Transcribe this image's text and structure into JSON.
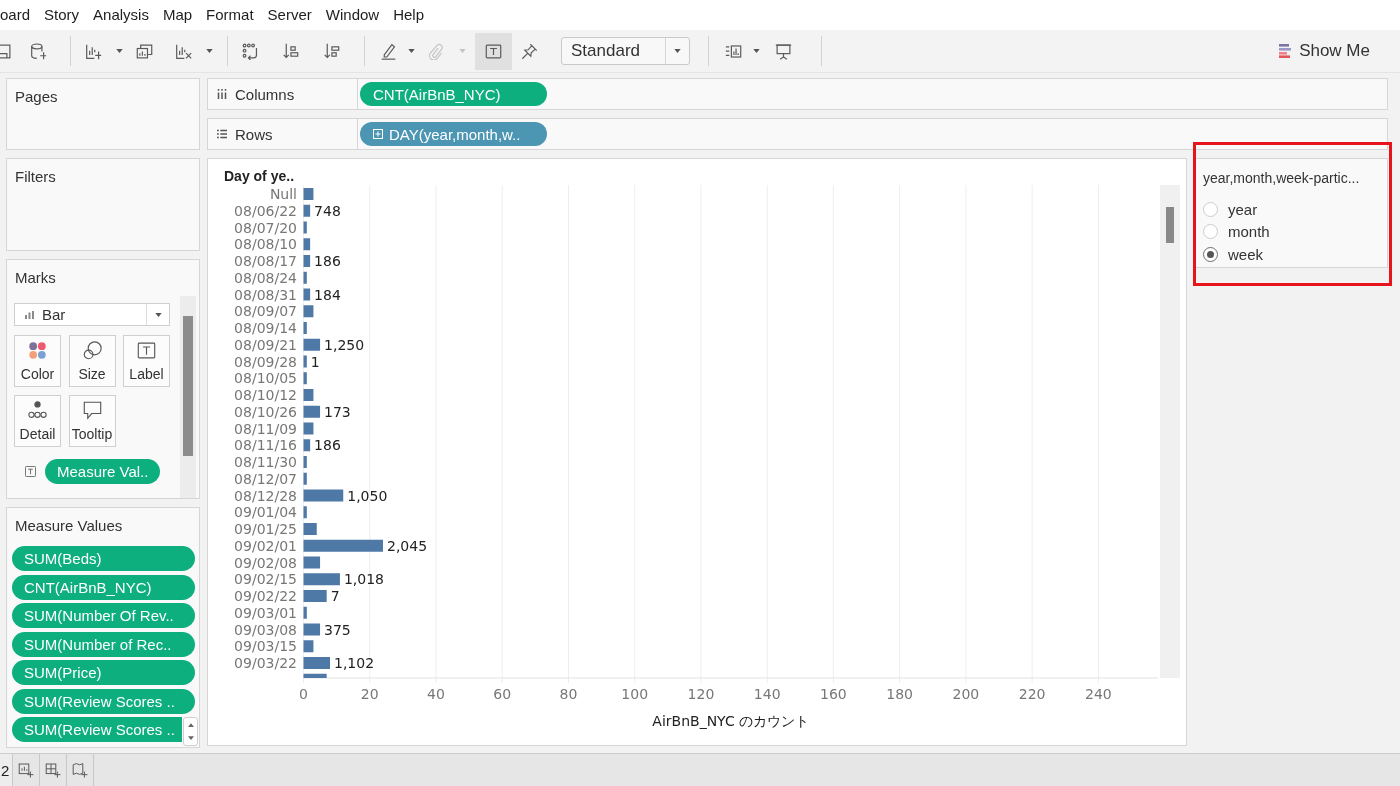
{
  "menu": [
    "oard",
    "Story",
    "Analysis",
    "Map",
    "Format",
    "Server",
    "Window",
    "Help"
  ],
  "toolbar": {
    "text_toggle": {
      "selected": true
    },
    "attach_button": {
      "disabled": true
    },
    "view_dropdown": {
      "value": "Standard"
    },
    "show_me": {
      "label": "Show Me"
    }
  },
  "left_panel": {
    "pages": {
      "title": "Pages"
    },
    "filters": {
      "title": "Filters"
    },
    "marks": {
      "title": "Marks",
      "mark_type": "Bar",
      "cards": [
        {
          "label": "Color",
          "kind": "color"
        },
        {
          "label": "Size",
          "kind": "size"
        },
        {
          "label": "Label",
          "kind": "label"
        },
        {
          "label": "Detail",
          "kind": "detail"
        },
        {
          "label": "Tooltip",
          "kind": "tooltip"
        }
      ],
      "pill": "Measure Val.."
    },
    "measure_values": {
      "title": "Measure Values",
      "pills": [
        "SUM(Beds)",
        "CNT(AirBnB_NYC)",
        "SUM(Number Of Rev..",
        "SUM(Number of Rec..",
        "SUM(Price)",
        "SUM(Review Scores ..",
        "SUM(Review Scores .."
      ]
    }
  },
  "shelves": [
    {
      "label": "Columns",
      "kind": "columns",
      "pills": [
        {
          "text": "CNT(AirBnB_NYC)",
          "kind": "continuous",
          "expandable": false
        }
      ]
    },
    {
      "label": "Rows",
      "kind": "rows",
      "pills": [
        {
          "text": "DAY(year,month,w..",
          "kind": "discrete",
          "expandable": true
        }
      ]
    }
  ],
  "view": {
    "chart_data": {
      "type": "bar",
      "orientation": "horizontal",
      "ylabel": "Day of ye..",
      "xlabel": "AirBnB_NYC のカウント",
      "categories": [
        "Null",
        "08/06/22",
        "08/07/20",
        "08/08/10",
        "08/08/17",
        "08/08/24",
        "08/08/31",
        "08/09/07",
        "08/09/14",
        "08/09/21",
        "08/09/28",
        "08/10/05",
        "08/10/12",
        "08/10/26",
        "08/11/09",
        "08/11/16",
        "08/11/30",
        "08/12/07",
        "08/12/28",
        "09/01/04",
        "09/01/25",
        "09/02/01",
        "09/02/08",
        "09/02/15",
        "09/02/22",
        "09/03/01",
        "09/03/08",
        "09/03/15",
        "09/03/22",
        null
      ],
      "values": [
        3,
        2,
        1,
        2,
        2,
        1,
        2,
        3,
        1,
        5,
        1,
        1,
        3,
        5,
        3,
        2,
        1,
        1,
        12,
        1,
        4,
        24,
        5,
        11,
        7,
        1,
        5,
        3,
        8,
        7
      ],
      "annotations": [
        null,
        "748",
        null,
        null,
        "186",
        null,
        "184",
        null,
        null,
        "1,250",
        "1",
        null,
        null,
        "173",
        null,
        "186",
        null,
        null,
        "1,050",
        null,
        null,
        "2,045",
        null,
        "1,018",
        "7",
        null,
        "375",
        null,
        "1,102",
        null
      ],
      "color": "#4e79a7",
      "xlim": [
        0,
        258
      ],
      "xticks": [
        0,
        20,
        40,
        60,
        80,
        100,
        120,
        140,
        160,
        180,
        200,
        220,
        240
      ],
      "grid": true
    }
  },
  "parameter": {
    "title": "year,month,week-partic...",
    "options": [
      {
        "label": "year",
        "selected": false
      },
      {
        "label": "month",
        "selected": false
      },
      {
        "label": "week",
        "selected": true
      }
    ]
  },
  "sheet_tabs": [
    {
      "label": "2"
    }
  ]
}
